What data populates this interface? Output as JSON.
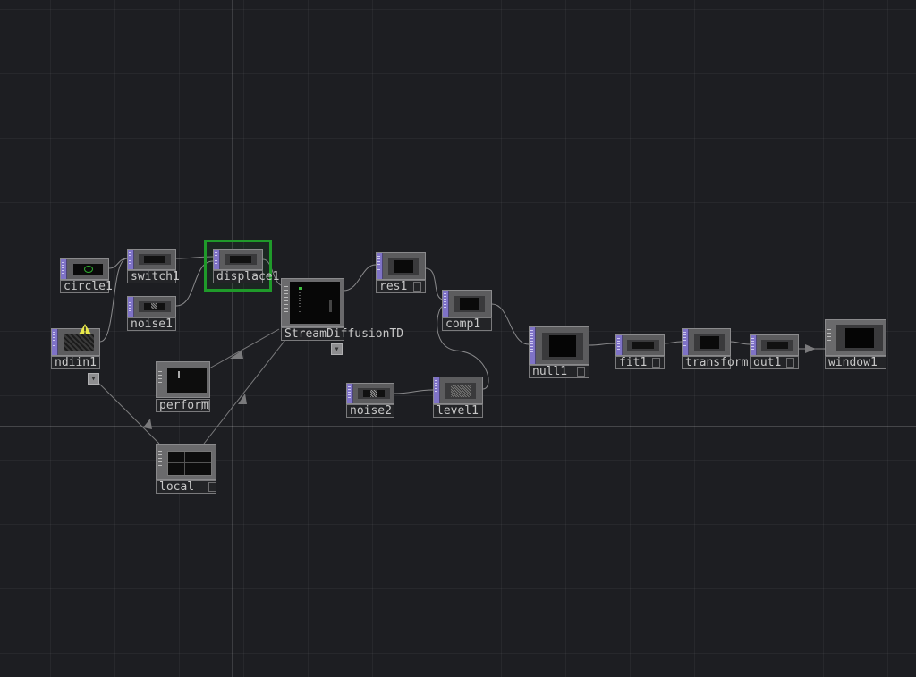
{
  "network": {
    "nodes": {
      "circle1": "circle1",
      "switch1": "switch1",
      "displace1": "displace1",
      "noise1": "noise1",
      "ndiin1": "ndiin1",
      "streamdiffusion": "StreamDiffusionTD",
      "res1": "res1",
      "comp1": "comp1",
      "perform": "perform",
      "noise2": "noise2",
      "level1": "level1",
      "null1": "null1",
      "fit1": "fit1",
      "transform": "transform",
      "out1": "out1",
      "window1": "window1",
      "local": "local"
    },
    "selected_node": "displace1",
    "warning_node": "ndiin1",
    "icons": {
      "warning": "warning-icon",
      "toggle": "toggle-icon"
    },
    "colors": {
      "background": "#1d1e22",
      "node_strip": "#7f73c7",
      "selection": "#1f9a2a",
      "warning": "#e8e84a",
      "wire": "#8a8a8c"
    }
  }
}
